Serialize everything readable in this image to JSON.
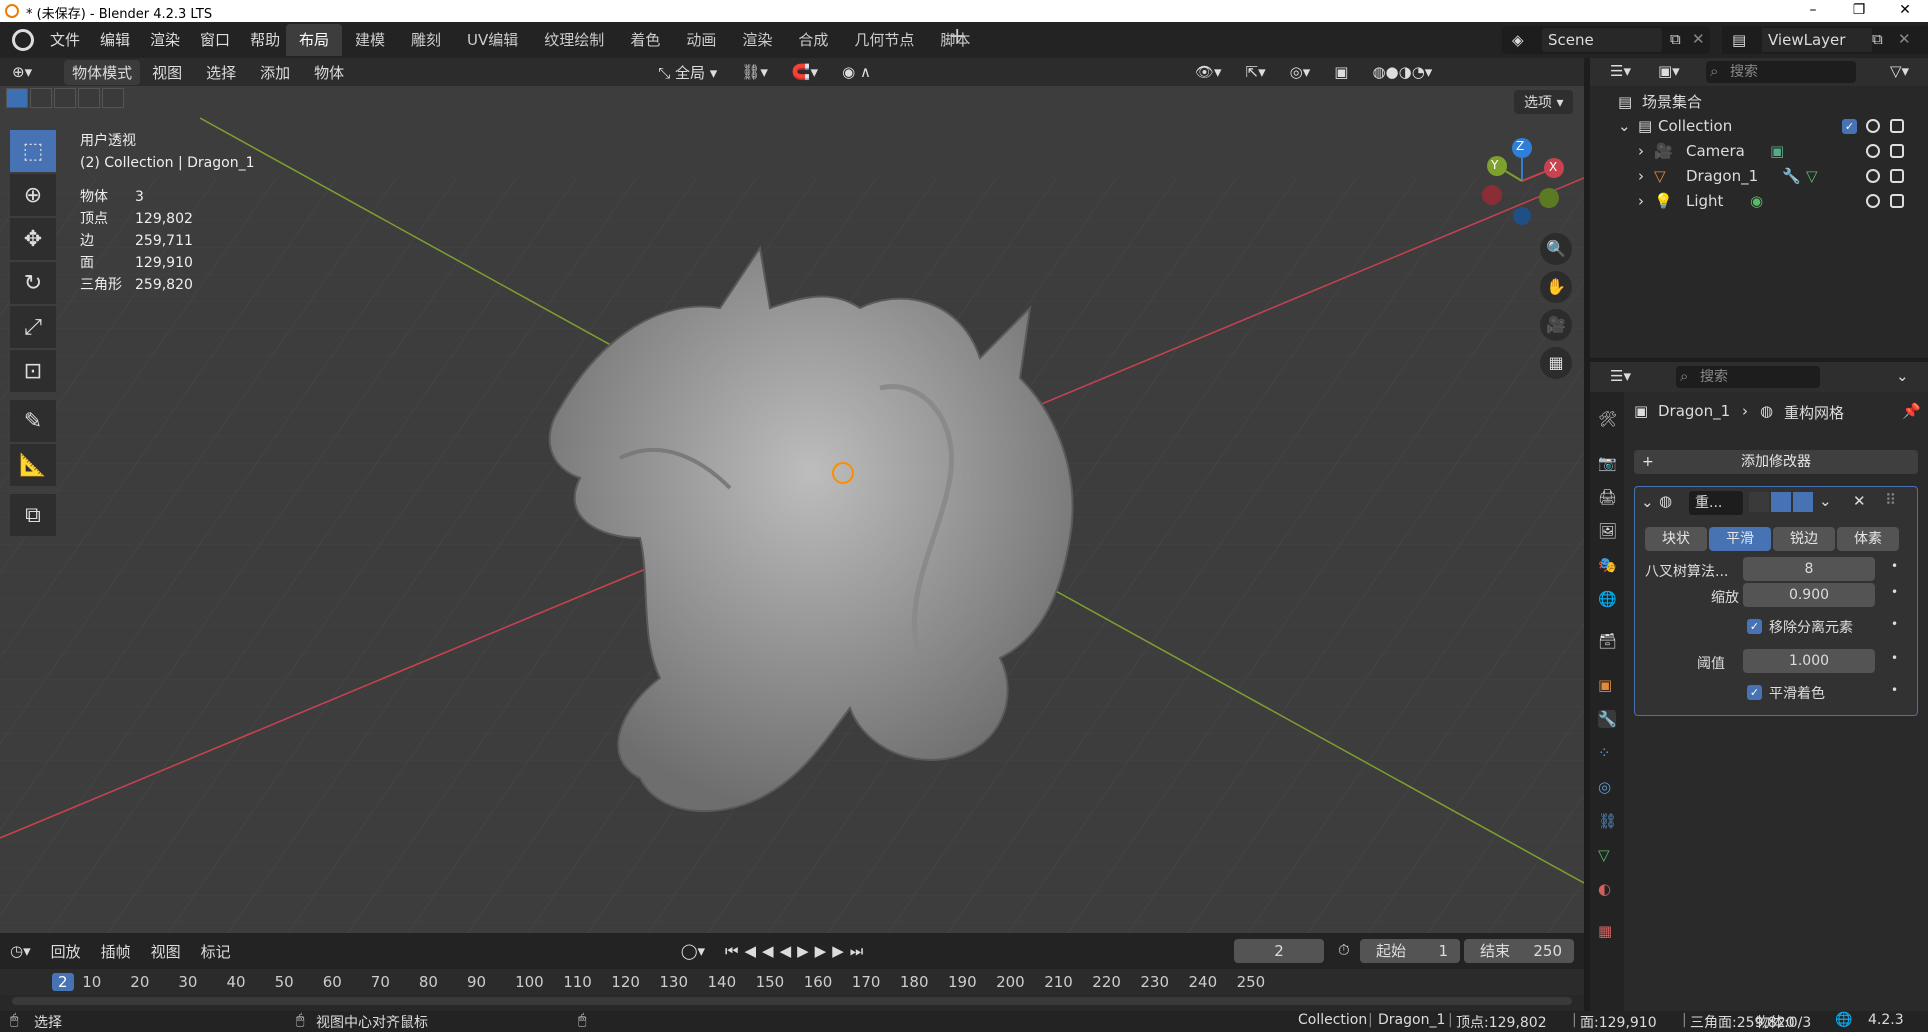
{
  "window": {
    "title": "* (未保存) - Blender 4.2.3 LTS"
  },
  "menu": [
    "文件",
    "编辑",
    "渲染",
    "窗口",
    "帮助"
  ],
  "workspaces": [
    {
      "label": "布局",
      "active": true
    },
    {
      "label": "建模"
    },
    {
      "label": "雕刻"
    },
    {
      "label": "UV编辑"
    },
    {
      "label": "纹理绘制"
    },
    {
      "label": "着色"
    },
    {
      "label": "动画"
    },
    {
      "label": "渲染"
    },
    {
      "label": "合成"
    },
    {
      "label": "几何节点"
    },
    {
      "label": "脚本"
    }
  ],
  "scene": {
    "name": "Scene"
  },
  "viewlayer": {
    "name": "ViewLayer"
  },
  "viewport": {
    "mode": "物体模式",
    "menus": [
      "视图",
      "选择",
      "添加",
      "物体"
    ],
    "transform": "全局",
    "options": "选项",
    "view_name": "用户透视",
    "context": "(2) Collection | Dragon_1",
    "stats": [
      {
        "k": "物体",
        "v": "3"
      },
      {
        "k": "顶点",
        "v": "129,802"
      },
      {
        "k": "边",
        "v": "259,711"
      },
      {
        "k": "面",
        "v": "129,910"
      },
      {
        "k": "三角形",
        "v": "259,820"
      }
    ],
    "gizmo": {
      "x": "X",
      "y": "Y",
      "z": "Z"
    }
  },
  "timeline": {
    "menus": [
      "回放",
      "插帧",
      "视图",
      "标记"
    ],
    "current_frame": "2",
    "start_label": "起始",
    "start": "1",
    "end_label": "结束",
    "end": "250",
    "ticks": [
      "2",
      "10",
      "20",
      "30",
      "40",
      "50",
      "60",
      "70",
      "80",
      "90",
      "100",
      "110",
      "120",
      "130",
      "140",
      "150",
      "160",
      "170",
      "180",
      "190",
      "200",
      "210",
      "220",
      "230",
      "240",
      "250"
    ]
  },
  "status": {
    "left": "选择",
    "middle": "视图中心对齐鼠标",
    "collection": "Collection",
    "object": "Dragon_1",
    "verts": "顶点:129,802",
    "faces": "面:129,910",
    "tris": "三角面:259,820",
    "objects": "物体:0/3",
    "version": "4.2.3"
  },
  "outliner": {
    "search_placeholder": "搜索",
    "scene_collection": "场景集合",
    "items": [
      {
        "name": "Collection"
      },
      {
        "name": "Camera"
      },
      {
        "name": "Dragon_1"
      },
      {
        "name": "Light"
      }
    ]
  },
  "properties": {
    "search_placeholder": "搜索",
    "breadcrumb_object": "Dragon_1",
    "breadcrumb_modifier": "重构网格",
    "add_modifier": "添加修改器",
    "modifier_name": "重...",
    "modes": [
      "块状",
      "平滑",
      "锐边",
      "体素"
    ],
    "octree_label": "八叉树算法...",
    "octree_value": "8",
    "scale_label": "缩放",
    "scale_value": "0.900",
    "remove_disconnected": "移除分离元素",
    "threshold_label": "阈值",
    "threshold_value": "1.000",
    "smooth_shading": "平滑着色"
  },
  "colors": {
    "accent": "#4772b3",
    "xaxis": "#c8434f",
    "yaxis": "#7ea02f",
    "zaxis": "#2f7fd6"
  }
}
